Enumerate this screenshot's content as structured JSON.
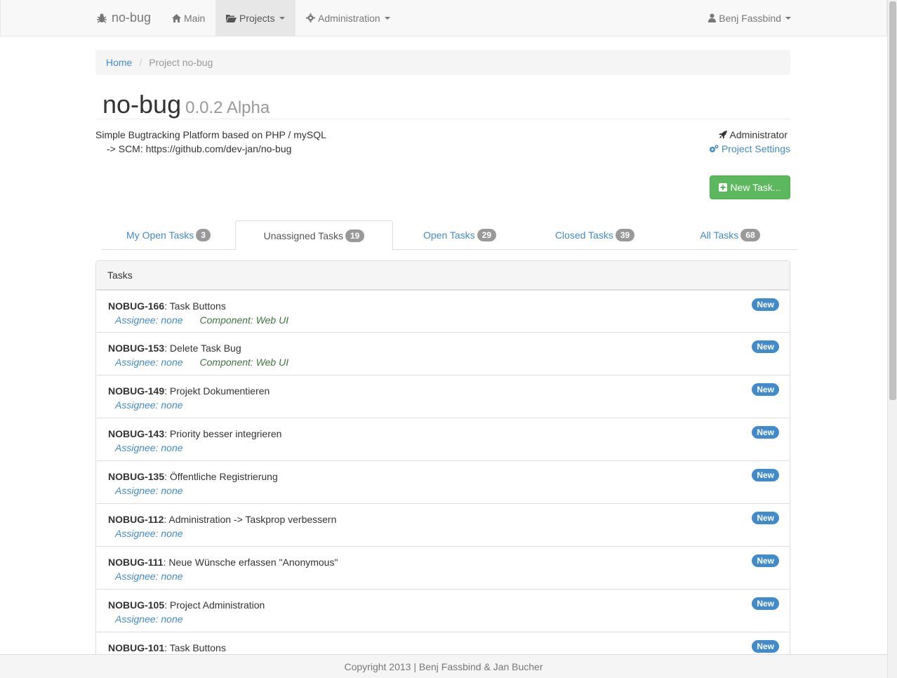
{
  "navbar": {
    "brand": "no-bug",
    "main_label": "Main",
    "projects_label": "Projects",
    "administration_label": "Administration",
    "user_label": "Benj Fassbind"
  },
  "breadcrumb": {
    "home": "Home",
    "current": "Project no-bug"
  },
  "project": {
    "name": "no-bug",
    "version": "0.0.2 Alpha",
    "description_line1": "Simple Bugtracking Platform based on PHP / mySQL",
    "description_line2": "-> SCM: https://github.com/dev-jan/no-bug",
    "role": "Administrator",
    "settings_label": "Project Settings",
    "new_task_label": "New Task..."
  },
  "tabs": [
    {
      "label": "My Open Tasks",
      "count": "3"
    },
    {
      "label": "Unassigned Tasks",
      "count": "19"
    },
    {
      "label": "Open Tasks",
      "count": "29"
    },
    {
      "label": "Closed Tasks",
      "count": "39"
    },
    {
      "label": "All Tasks",
      "count": "68"
    }
  ],
  "panel": {
    "heading": "Tasks"
  },
  "tasks": [
    {
      "key": "NOBUG-166",
      "title": ": Task Buttons",
      "assignee": "Assignee: none",
      "component": "Component: Web UI",
      "status": "New"
    },
    {
      "key": "NOBUG-153",
      "title": ": Delete Task Bug",
      "assignee": "Assignee: none",
      "component": "Component: Web UI",
      "status": "New"
    },
    {
      "key": "NOBUG-149",
      "title": ": Projekt Dokumentieren",
      "assignee": "Assignee: none",
      "component": "",
      "status": "New"
    },
    {
      "key": "NOBUG-143",
      "title": ": Priority besser integrieren",
      "assignee": "Assignee: none",
      "component": "",
      "status": "New"
    },
    {
      "key": "NOBUG-135",
      "title": ": Öffentliche Registrierung",
      "assignee": "Assignee: none",
      "component": "",
      "status": "New"
    },
    {
      "key": "NOBUG-112",
      "title": ": Administration -> Taskprop verbessern",
      "assignee": "Assignee: none",
      "component": "",
      "status": "New"
    },
    {
      "key": "NOBUG-111",
      "title": ": Neue Wünsche erfassen \"Anonymous\"",
      "assignee": "Assignee: none",
      "component": "",
      "status": "New"
    },
    {
      "key": "NOBUG-105",
      "title": ": Project Administration",
      "assignee": "Assignee: none",
      "component": "",
      "status": "New"
    },
    {
      "key": "NOBUG-101",
      "title": ": Task Buttons",
      "assignee": "",
      "component": "",
      "status": "New"
    }
  ],
  "footer": {
    "text": "Copyright 2013 | Benj Fassbind & Jan Bucher"
  },
  "colors": {
    "link": "#428bca",
    "success": "#5cb85c",
    "component": "#3c763d",
    "badge_gray": "#999999"
  }
}
